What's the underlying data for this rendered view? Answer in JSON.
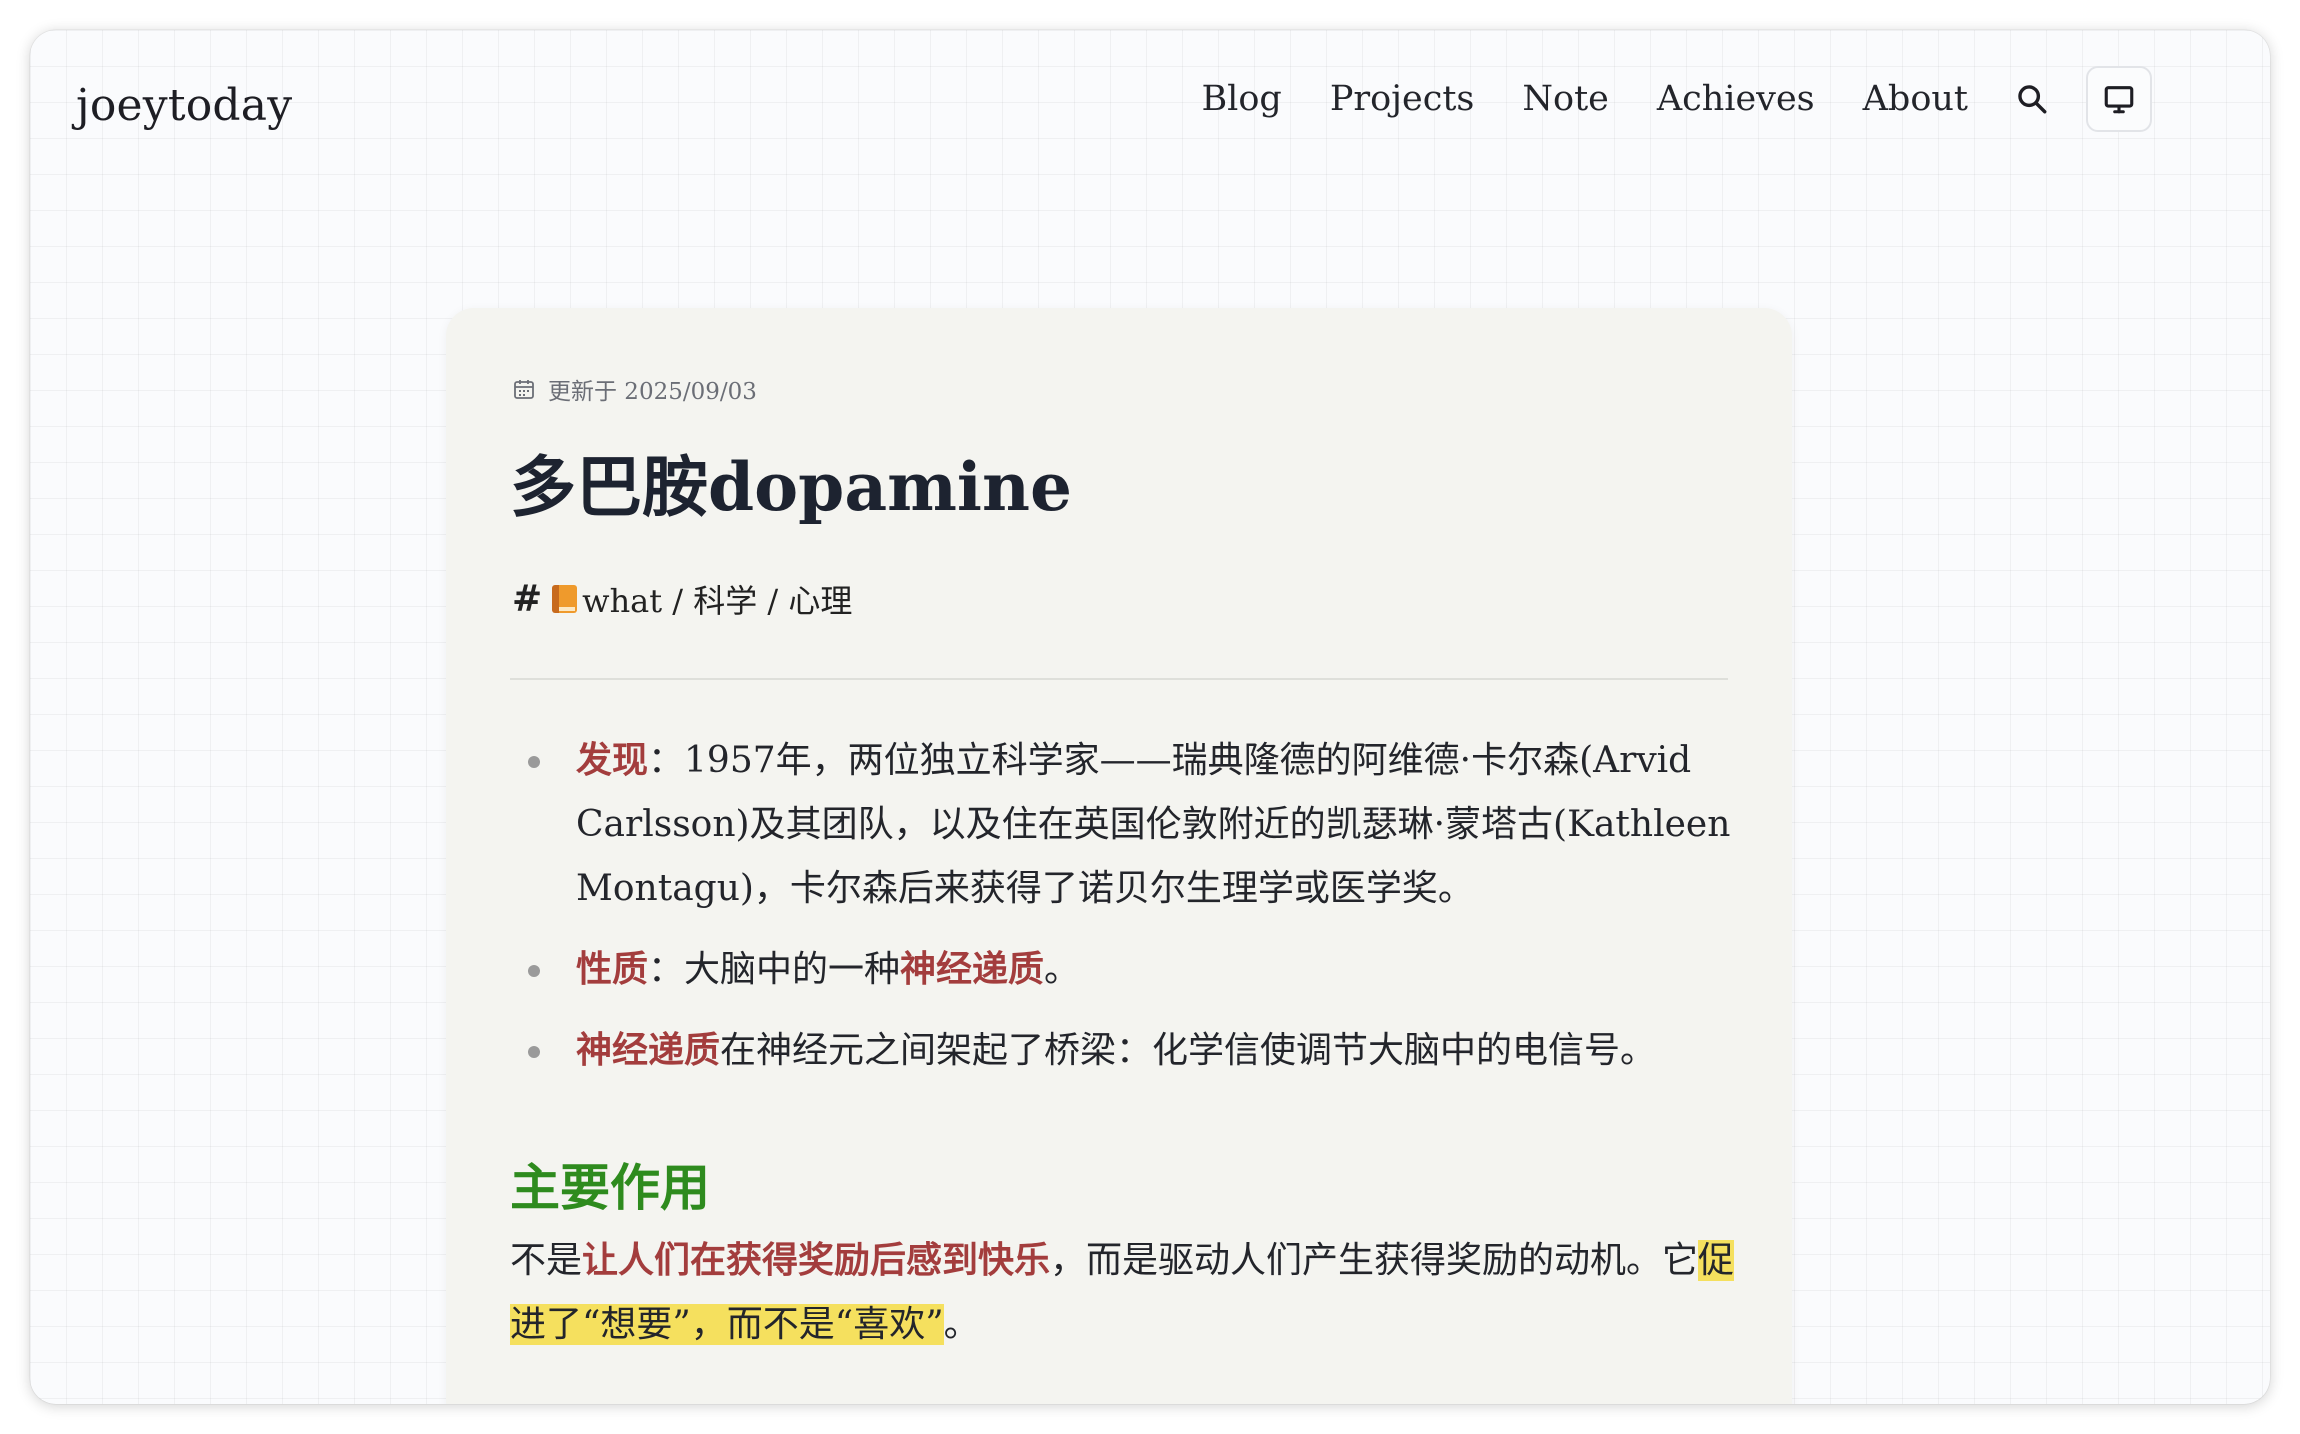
{
  "site": {
    "logo": "joeytoday",
    "nav": [
      "Blog",
      "Projects",
      "Note",
      "Achieves",
      "About"
    ],
    "search_icon": "search-icon",
    "theme_icon": "monitor-icon"
  },
  "article": {
    "updated": "更新于 2025/09/03",
    "title": "多巴胺dopamine",
    "tag_hash": "#",
    "tag_text": "what / 科学 / 心理",
    "bullets": [
      {
        "label": "发现",
        "text": "：1957年，两位独立科学家——瑞典隆德的阿维德·卡尔森(Arvid Carlsson)及其团队，以及住在英国伦敦附近的凯瑟琳·蒙塔古(Kathleen Montagu)，卡尔森后来获得了诺贝尔生理学或医学奖。"
      },
      {
        "label": "性质",
        "text_pre": "：大脑中的一种",
        "term": "神经递质",
        "text_post": "。"
      },
      {
        "term": "神经递质",
        "text": "在神经元之间架起了桥梁：化学信使调节大脑中的电信号。"
      }
    ],
    "section_heading": "主要作用",
    "para_pre": "不是",
    "para_hl": "让人们在获得奖励后感到快乐",
    "para_mid": "，而是驱动人们产生获得奖励的动机。它",
    "para_mark": "促进了“想要”，而不是“喜欢”",
    "para_end": "。"
  },
  "colors": {
    "accent_red": "#a33d3d",
    "heading_green": "#2e8b1e",
    "highlight_yellow": "#f5e05e",
    "card_bg": "#f4f4f0"
  }
}
